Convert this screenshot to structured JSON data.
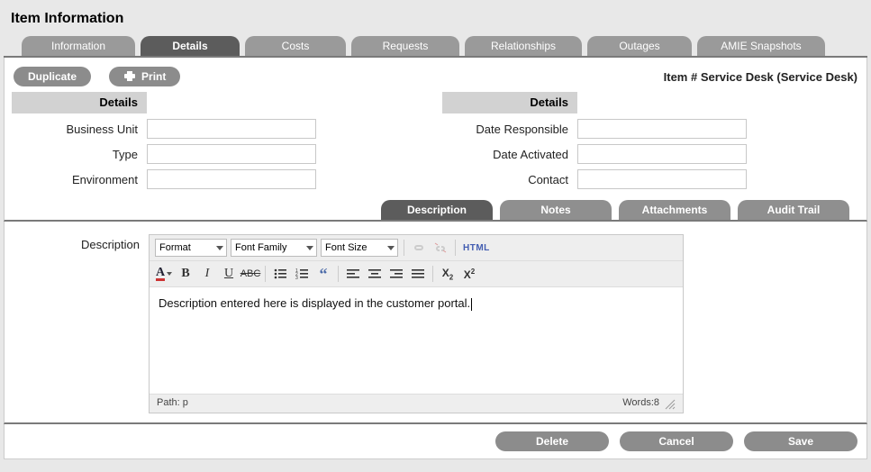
{
  "page_title": "Item Information",
  "tabs": [
    "Information",
    "Details",
    "Costs",
    "Requests",
    "Relationships",
    "Outages",
    "AMIE Snapshots"
  ],
  "active_tab": 1,
  "actions": {
    "duplicate": "Duplicate",
    "print": "Print"
  },
  "item_header": "Item # Service Desk (Service Desk)",
  "left_panel": {
    "heading": "Details",
    "fields": [
      {
        "label": "Business Unit",
        "value": ""
      },
      {
        "label": "Type",
        "value": ""
      },
      {
        "label": "Environment",
        "value": ""
      }
    ]
  },
  "right_panel": {
    "heading": "Details",
    "fields": [
      {
        "label": "Date Responsible",
        "value": ""
      },
      {
        "label": "Date Activated",
        "value": ""
      },
      {
        "label": "Contact",
        "value": ""
      }
    ]
  },
  "subtabs": [
    "Description",
    "Notes",
    "Attachments",
    "Audit Trail"
  ],
  "active_subtab": 0,
  "description": {
    "label": "Description",
    "toolbar": {
      "format": "Format",
      "font_family": "Font Family",
      "font_size": "Font Size",
      "html": "HTML"
    },
    "content": "Description entered here is displayed in the customer portal.",
    "path": "Path: p",
    "word_count": "Words:8"
  },
  "footer_buttons": {
    "delete": "Delete",
    "cancel": "Cancel",
    "save": "Save"
  }
}
